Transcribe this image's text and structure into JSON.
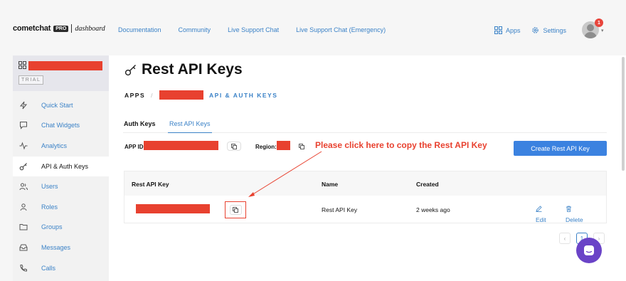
{
  "header": {
    "brand": "cometchat",
    "pro_badge": "PRO",
    "dashboard_label": "dashboard",
    "nav": [
      "Documentation",
      "Community",
      "Live Support Chat",
      "Live Support Chat (Emergency)"
    ],
    "apps_label": "Apps",
    "settings_label": "Settings",
    "notification_count": "1"
  },
  "sidebar": {
    "trial_badge": "TRIAL",
    "items": [
      {
        "label": "Quick Start",
        "icon": "bolt-icon"
      },
      {
        "label": "Chat Widgets",
        "icon": "chat-bubble-icon"
      },
      {
        "label": "Analytics",
        "icon": "pulse-icon"
      },
      {
        "label": "API & Auth Keys",
        "icon": "key-icon"
      },
      {
        "label": "Users",
        "icon": "users-icon"
      },
      {
        "label": "Roles",
        "icon": "user-icon"
      },
      {
        "label": "Groups",
        "icon": "folder-icon"
      },
      {
        "label": "Messages",
        "icon": "inbox-icon"
      },
      {
        "label": "Calls",
        "icon": "phone-icon"
      }
    ]
  },
  "page": {
    "title": "Rest API Keys",
    "breadcrumb_apps": "APPS",
    "breadcrumb_sep": "/",
    "breadcrumb_current": "API & AUTH KEYS",
    "tabs": [
      "Auth Keys",
      "Rest API Keys"
    ],
    "app_id_label": "APP ID:",
    "region_label": "Region:",
    "hint": "Please click here to copy the Rest API Key",
    "create_button": "Create Rest API Key"
  },
  "table": {
    "headers": [
      "Rest API Key",
      "Name",
      "Created"
    ],
    "rows": [
      {
        "name": "Rest API Key",
        "created": "2 weeks ago",
        "edit": "Edit",
        "delete": "Delete"
      }
    ]
  },
  "pagination": {
    "current_page": "1"
  },
  "colors": {
    "accent": "#3b82c7",
    "annotation": "#e8412f",
    "button": "#3b82e0",
    "chat_fab": "#6a43c7"
  }
}
